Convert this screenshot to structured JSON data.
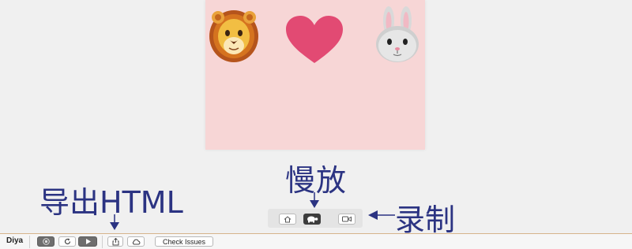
{
  "canvas": {
    "background": "#f7d6d6",
    "emojis": [
      "lion-face-icon",
      "heart-icon",
      "rabbit-face-icon"
    ]
  },
  "annotations": {
    "slow_motion": "慢放",
    "export_html": "导出HTML",
    "record": "录制",
    "color": "#2b3382"
  },
  "playback_controls": {
    "buttons": [
      {
        "icon": "home-icon",
        "active": false
      },
      {
        "icon": "turtle-icon",
        "active": true
      },
      {
        "icon": "video-camera-icon",
        "active": false
      }
    ]
  },
  "toolbar": {
    "app_name": "Diya",
    "buttons": [
      {
        "icon": "stop-circle-icon"
      },
      {
        "icon": "refresh-icon"
      },
      {
        "icon": "play-icon"
      },
      {
        "icon": "share-icon"
      },
      {
        "icon": "cloud-icon"
      }
    ],
    "check_issues_label": "Check Issues",
    "accent_border": "#d6b48a"
  }
}
